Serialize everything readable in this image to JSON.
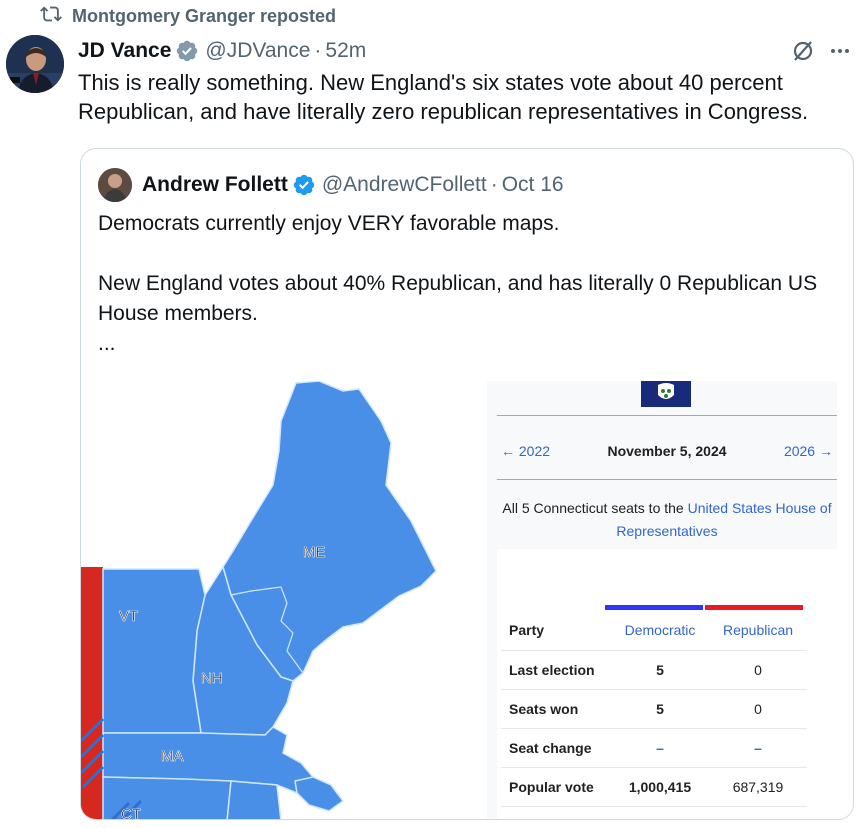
{
  "repost": {
    "text": "Montgomery Granger reposted",
    "icon": "repost-icon"
  },
  "tweet": {
    "author_name": "JD Vance",
    "handle": "@JDVance",
    "separator": "·",
    "time": "52m",
    "text": "This is really something. New England's six states vote about 40 percent Republican, and have literally zero republican representatives in Congress."
  },
  "quote": {
    "author_name": "Andrew Follett",
    "handle": "@AndrewCFollett",
    "separator": "·",
    "time": "Oct 16",
    "line1": "Democrats currently enjoy VERY favorable maps.",
    "line2": "New England votes about 40% Republican, and has literally 0 Republican US House members.",
    "line3": "..."
  },
  "map": {
    "labels": {
      "me": "ME",
      "vt": "VT",
      "nh": "NH",
      "ma": "MA",
      "ct": "CT"
    },
    "colors": {
      "democratic": "#4a8fe7",
      "republican": "#d6281f",
      "border": "#cfe7ff"
    }
  },
  "wiki": {
    "prev": "← 2022",
    "date": "November 5, 2024",
    "next": "2026 →",
    "desc_prefix": "All 5 Connecticut seats to the ",
    "desc_link": "United States House of Representatives",
    "col_dem": "Democratic",
    "col_rep": "Republican",
    "rows": [
      {
        "label": "Party",
        "d": "Democratic",
        "r": "Republican"
      },
      {
        "label": "Last election",
        "d": "5",
        "r": "0"
      },
      {
        "label": "Seats won",
        "d": "5",
        "r": "0"
      },
      {
        "label": "Seat change",
        "d": "–",
        "r": "–"
      },
      {
        "label": "Popular vote",
        "d": "1,000,415",
        "r": "687,319"
      }
    ]
  }
}
